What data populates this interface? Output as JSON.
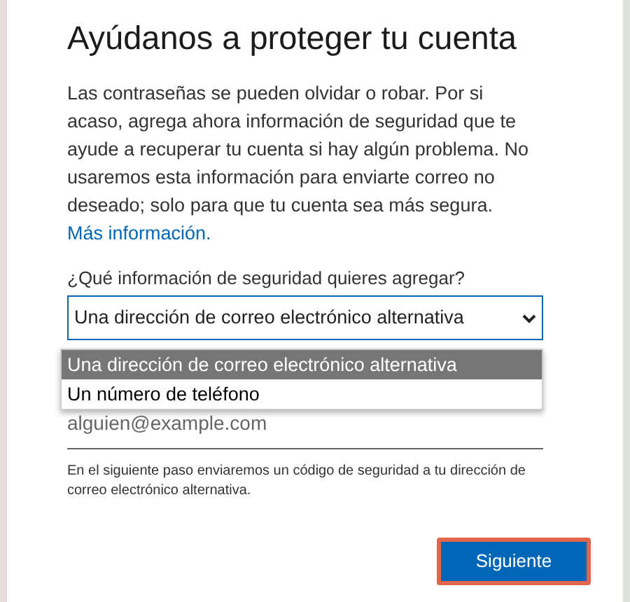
{
  "title": "Ayúdanos a proteger tu cuenta",
  "intro": {
    "text": "Las contraseñas se pueden olvidar o robar. Por si acaso, agrega ahora información de seguridad que te ayude a recuperar tu cuenta si hay algún problema. No usaremos esta información para enviarte correo no deseado; solo para que tu cuenta sea más segura.",
    "link": "Más información."
  },
  "question": "¿Qué información de seguridad quieres agregar?",
  "select": {
    "value": "Una dirección de correo electrónico alternativa",
    "expanded": true,
    "options": [
      {
        "label": "Una dirección de correo electrónico alternativa",
        "selected": true
      },
      {
        "label": "Un número de teléfono",
        "selected": false
      }
    ]
  },
  "email": {
    "placeholder": "alguien@example.com"
  },
  "note": "En el siguiente paso enviaremos un código de seguridad a tu dirección de correo electrónico alternativa.",
  "next_button": "Siguiente"
}
